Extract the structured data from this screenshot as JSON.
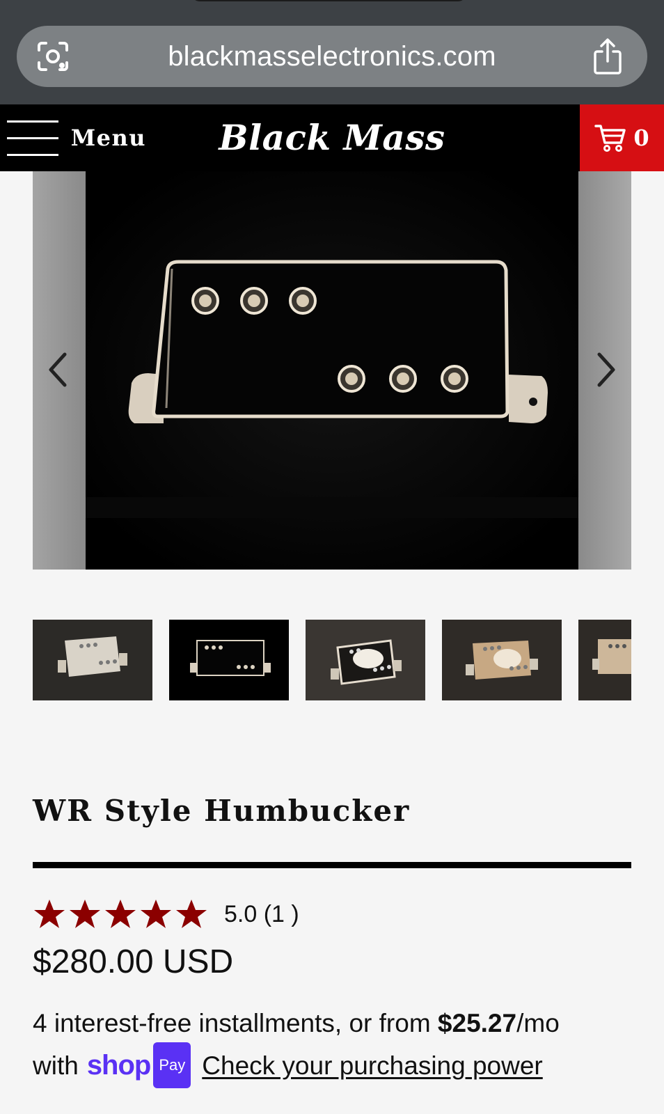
{
  "browser": {
    "url": "blackmasselectronics.com",
    "lens_icon": "camera-search-icon",
    "share_icon": "share-icon"
  },
  "header": {
    "menu_label": "Menu",
    "brand": "Black Mass",
    "cart_count": "0",
    "cart_icon": "cart-icon",
    "cart_color": "#d60f13"
  },
  "carousel": {
    "prev_icon": "chevron-left-icon",
    "next_icon": "chevron-right-icon",
    "thumbnail_count_visible": 5,
    "active_thumbnail": 2
  },
  "product": {
    "title": "WR Style Humbucker",
    "rating": {
      "stars": 5,
      "text": "5.0 (1 )",
      "star_color": "#8b0000"
    },
    "price": "$280.00 USD",
    "installments": {
      "prefix": "4 interest-free installments, or from ",
      "amount": "$25.27",
      "suffix": "/mo",
      "with": "with",
      "shop_word": "shop",
      "pay_badge": "Pay",
      "link": "Check your purchasing power",
      "shoppay_color": "#5a31f4"
    }
  }
}
